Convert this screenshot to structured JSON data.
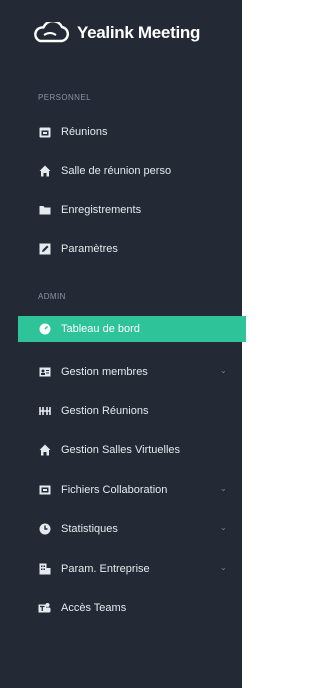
{
  "brand": {
    "name": "Yealink Meeting",
    "logo_icon": "cloud-logo-icon"
  },
  "sections": {
    "personal_label": "PERSONNEL",
    "admin_label": "ADMIN"
  },
  "personal_items": [
    {
      "label": "Réunions",
      "icon": "calendar-icon"
    },
    {
      "label": "Salle de réunion perso",
      "icon": "home-icon"
    },
    {
      "label": "Enregistrements",
      "icon": "folder-icon"
    },
    {
      "label": "Paramètres",
      "icon": "edit-settings-icon"
    }
  ],
  "admin_items": [
    {
      "label": "Tableau de bord",
      "icon": "dashboard-icon",
      "active": true
    },
    {
      "label": "Gestion membres",
      "icon": "members-card-icon",
      "expandable": true
    },
    {
      "label": "Gestion Réunions",
      "icon": "meetings-icon"
    },
    {
      "label": "Gestion Salles Virtuelles",
      "icon": "virtual-room-icon"
    },
    {
      "label": "Fichiers Collaboration",
      "icon": "collab-files-icon",
      "expandable": true
    },
    {
      "label": "Statistiques",
      "icon": "statistics-clock-icon",
      "expandable": true
    },
    {
      "label": "Param. Entreprise",
      "icon": "enterprise-settings-icon",
      "expandable": true
    },
    {
      "label": "Accès Teams",
      "icon": "teams-icon"
    }
  ],
  "colors": {
    "sidebar_bg": "#232a36",
    "active_bg": "#2fc39a",
    "section_label": "#8b93a1"
  }
}
